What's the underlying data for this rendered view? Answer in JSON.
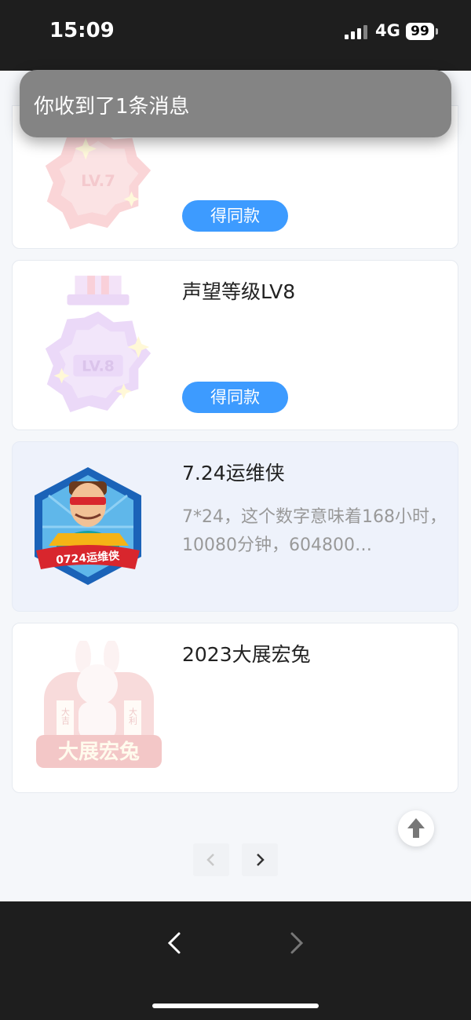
{
  "status_bar": {
    "time": "15:09",
    "network": "4G",
    "battery": "99"
  },
  "toast": {
    "message": "你收到了1条消息"
  },
  "cards": [
    {
      "title": "",
      "badge": "LV.7",
      "button": "得同款"
    },
    {
      "title": "声望等级LV8",
      "badge": "LV.8",
      "button": "得同款"
    },
    {
      "title": "7.24运维侠",
      "badge": "0724运维侠",
      "description": "7*24，这个数字意味着168小时，10080分钟，604800…"
    },
    {
      "title": "2023大展宏兔",
      "badge": "大展宏兔",
      "badge_small_left": "大吉",
      "badge_small_right": "大利"
    }
  ],
  "icons": {
    "scroll_top": "arrow-up-icon",
    "pagination_prev": "chevron-left-icon",
    "pagination_next": "chevron-right-icon",
    "browser_back": "chevron-left-icon",
    "browser_forward": "chevron-right-icon"
  },
  "colors": {
    "accent": "#3d9bff",
    "highlight_card": "#eef2fb",
    "toast": "#848484",
    "bars": "#1e1e1e"
  }
}
